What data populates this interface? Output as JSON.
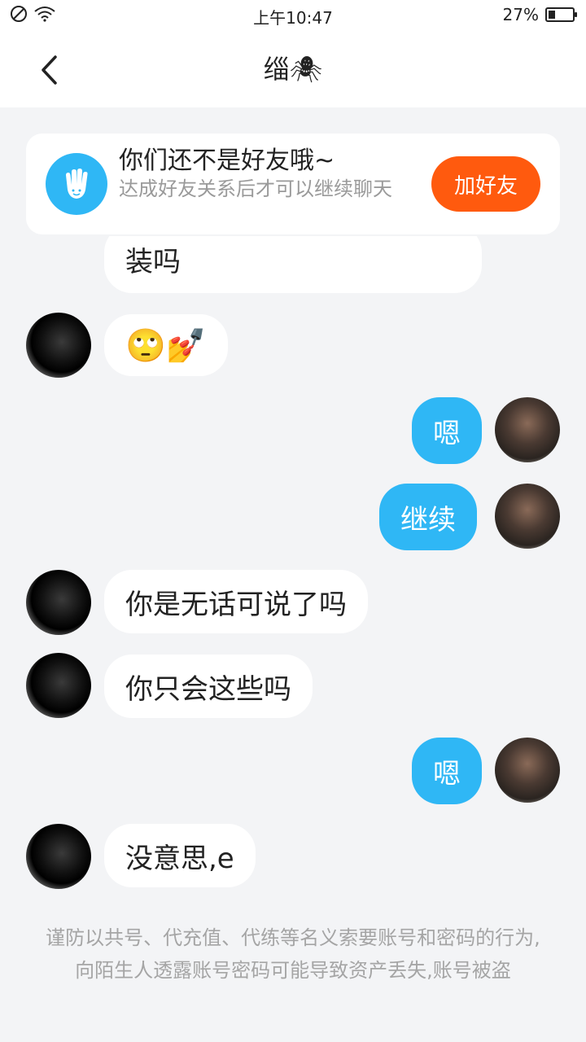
{
  "status_bar": {
    "time": "上午10:47",
    "battery_level": "27%",
    "battery_fraction": 0.27
  },
  "header": {
    "title": "缁🕷"
  },
  "friend_prompt": {
    "title": "你们还不是好友哦~",
    "description": "达成好友关系后才可以继续聊天",
    "button_label": "加好友"
  },
  "messages": [
    {
      "side": "in",
      "text": "装吗"
    },
    {
      "side": "in",
      "text": "🙄💅"
    },
    {
      "side": "out",
      "text": "嗯"
    },
    {
      "side": "out",
      "text": "继续"
    },
    {
      "side": "in",
      "text": "你是无话可说了吗"
    },
    {
      "side": "in",
      "text": "你只会这些吗"
    },
    {
      "side": "out",
      "text": "嗯"
    },
    {
      "side": "in",
      "text": "没意思,e"
    }
  ],
  "disclaimer": "谨防以共号、代充值、代练等名义索要账号和密码的行为,向陌生人透露账号密码可能导致资产丢失,账号被盗",
  "icons": {
    "no_disturb": "no-disturb-icon",
    "wifi": "wifi-icon",
    "back": "back-chevron-icon",
    "hand": "hand-icon",
    "battery": "battery-icon"
  }
}
